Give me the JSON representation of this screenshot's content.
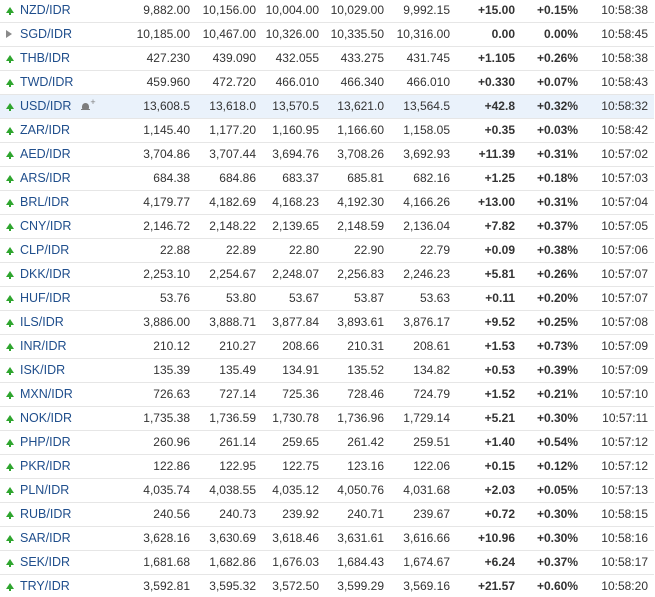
{
  "colors": {
    "link": "#1f4e8c",
    "positive": "#1c9b1c",
    "up_arrow": "#2ea52e",
    "flat_arrow": "#8a8a8a",
    "highlight_row": "#eaf2fb",
    "row_border": "#e6e6e6"
  },
  "rows": [
    {
      "pair": "NZD/IDR",
      "trend": "up",
      "last": "9,882.00",
      "open": "10,156.00",
      "high": "10,004.00",
      "low": "10,029.00",
      "prev": "9,992.15",
      "change": "+15.00",
      "change_pct": "+0.15%",
      "time": "10:58:38"
    },
    {
      "pair": "SGD/IDR",
      "trend": "flat",
      "last": "10,185.00",
      "open": "10,467.00",
      "high": "10,326.00",
      "low": "10,335.50",
      "prev": "10,316.00",
      "change": "0.00",
      "change_pct": "0.00%",
      "time": "10:58:45"
    },
    {
      "pair": "THB/IDR",
      "trend": "up",
      "last": "427.230",
      "open": "439.090",
      "high": "432.055",
      "low": "433.275",
      "prev": "431.745",
      "change": "+1.105",
      "change_pct": "+0.26%",
      "time": "10:58:38"
    },
    {
      "pair": "TWD/IDR",
      "trend": "up",
      "last": "459.960",
      "open": "472.720",
      "high": "466.010",
      "low": "466.340",
      "prev": "466.010",
      "change": "+0.330",
      "change_pct": "+0.07%",
      "time": "10:58:43"
    },
    {
      "pair": "USD/IDR",
      "trend": "up",
      "highlight": true,
      "bell": true,
      "last": "13,608.5",
      "open": "13,618.0",
      "high": "13,570.5",
      "low": "13,621.0",
      "prev": "13,564.5",
      "change": "+42.8",
      "change_pct": "+0.32%",
      "time": "10:58:32"
    },
    {
      "pair": "ZAR/IDR",
      "trend": "up",
      "last": "1,145.40",
      "open": "1,177.20",
      "high": "1,160.95",
      "low": "1,166.60",
      "prev": "1,158.05",
      "change": "+0.35",
      "change_pct": "+0.03%",
      "time": "10:58:42"
    },
    {
      "pair": "AED/IDR",
      "trend": "up",
      "last": "3,704.86",
      "open": "3,707.44",
      "high": "3,694.76",
      "low": "3,708.26",
      "prev": "3,692.93",
      "change": "+11.39",
      "change_pct": "+0.31%",
      "time": "10:57:02"
    },
    {
      "pair": "ARS/IDR",
      "trend": "up",
      "last": "684.38",
      "open": "684.86",
      "high": "683.37",
      "low": "685.81",
      "prev": "682.16",
      "change": "+1.25",
      "change_pct": "+0.18%",
      "time": "10:57:03"
    },
    {
      "pair": "BRL/IDR",
      "trend": "up",
      "last": "4,179.77",
      "open": "4,182.69",
      "high": "4,168.23",
      "low": "4,192.30",
      "prev": "4,166.26",
      "change": "+13.00",
      "change_pct": "+0.31%",
      "time": "10:57:04"
    },
    {
      "pair": "CNY/IDR",
      "trend": "up",
      "last": "2,146.72",
      "open": "2,148.22",
      "high": "2,139.65",
      "low": "2,148.59",
      "prev": "2,136.04",
      "change": "+7.82",
      "change_pct": "+0.37%",
      "time": "10:57:05"
    },
    {
      "pair": "CLP/IDR",
      "trend": "up",
      "last": "22.88",
      "open": "22.89",
      "high": "22.80",
      "low": "22.90",
      "prev": "22.79",
      "change": "+0.09",
      "change_pct": "+0.38%",
      "time": "10:57:06"
    },
    {
      "pair": "DKK/IDR",
      "trend": "up",
      "last": "2,253.10",
      "open": "2,254.67",
      "high": "2,248.07",
      "low": "2,256.83",
      "prev": "2,246.23",
      "change": "+5.81",
      "change_pct": "+0.26%",
      "time": "10:57:07"
    },
    {
      "pair": "HUF/IDR",
      "trend": "up",
      "last": "53.76",
      "open": "53.80",
      "high": "53.67",
      "low": "53.87",
      "prev": "53.63",
      "change": "+0.11",
      "change_pct": "+0.20%",
      "time": "10:57:07"
    },
    {
      "pair": "ILS/IDR",
      "trend": "up",
      "last": "3,886.00",
      "open": "3,888.71",
      "high": "3,877.84",
      "low": "3,893.61",
      "prev": "3,876.17",
      "change": "+9.52",
      "change_pct": "+0.25%",
      "time": "10:57:08"
    },
    {
      "pair": "INR/IDR",
      "trend": "up",
      "last": "210.12",
      "open": "210.27",
      "high": "208.66",
      "low": "210.31",
      "prev": "208.61",
      "change": "+1.53",
      "change_pct": "+0.73%",
      "time": "10:57:09"
    },
    {
      "pair": "ISK/IDR",
      "trend": "up",
      "last": "135.39",
      "open": "135.49",
      "high": "134.91",
      "low": "135.52",
      "prev": "134.82",
      "change": "+0.53",
      "change_pct": "+0.39%",
      "time": "10:57:09"
    },
    {
      "pair": "MXN/IDR",
      "trend": "up",
      "last": "726.63",
      "open": "727.14",
      "high": "725.36",
      "low": "728.46",
      "prev": "724.79",
      "change": "+1.52",
      "change_pct": "+0.21%",
      "time": "10:57:10"
    },
    {
      "pair": "NOK/IDR",
      "trend": "up",
      "last": "1,735.38",
      "open": "1,736.59",
      "high": "1,730.78",
      "low": "1,736.96",
      "prev": "1,729.14",
      "change": "+5.21",
      "change_pct": "+0.30%",
      "time": "10:57:11"
    },
    {
      "pair": "PHP/IDR",
      "trend": "up",
      "last": "260.96",
      "open": "261.14",
      "high": "259.65",
      "low": "261.42",
      "prev": "259.51",
      "change": "+1.40",
      "change_pct": "+0.54%",
      "time": "10:57:12"
    },
    {
      "pair": "PKR/IDR",
      "trend": "up",
      "last": "122.86",
      "open": "122.95",
      "high": "122.75",
      "low": "123.16",
      "prev": "122.06",
      "change": "+0.15",
      "change_pct": "+0.12%",
      "time": "10:57:12"
    },
    {
      "pair": "PLN/IDR",
      "trend": "up",
      "last": "4,035.74",
      "open": "4,038.55",
      "high": "4,035.12",
      "low": "4,050.76",
      "prev": "4,031.68",
      "change": "+2.03",
      "change_pct": "+0.05%",
      "time": "10:57:13"
    },
    {
      "pair": "RUB/IDR",
      "trend": "up",
      "last": "240.56",
      "open": "240.73",
      "high": "239.92",
      "low": "240.71",
      "prev": "239.67",
      "change": "+0.72",
      "change_pct": "+0.30%",
      "time": "10:58:15"
    },
    {
      "pair": "SAR/IDR",
      "trend": "up",
      "last": "3,628.16",
      "open": "3,630.69",
      "high": "3,618.46",
      "low": "3,631.61",
      "prev": "3,616.66",
      "change": "+10.96",
      "change_pct": "+0.30%",
      "time": "10:58:16"
    },
    {
      "pair": "SEK/IDR",
      "trend": "up",
      "last": "1,681.68",
      "open": "1,682.86",
      "high": "1,676.03",
      "low": "1,684.43",
      "prev": "1,674.67",
      "change": "+6.24",
      "change_pct": "+0.37%",
      "time": "10:58:17"
    },
    {
      "pair": "TRY/IDR",
      "trend": "up",
      "last": "3,592.81",
      "open": "3,595.32",
      "high": "3,572.50",
      "low": "3,599.29",
      "prev": "3,569.16",
      "change": "+21.57",
      "change_pct": "+0.60%",
      "time": "10:58:20"
    }
  ]
}
